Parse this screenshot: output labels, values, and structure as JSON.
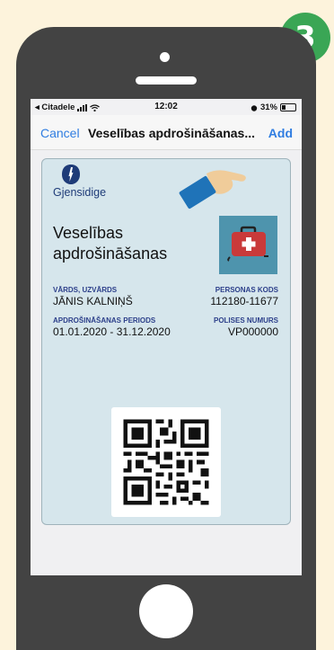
{
  "step": {
    "number": "3",
    "color": "#3aa655"
  },
  "status_bar": {
    "carrier": "◂ Citadele",
    "time": "12:02",
    "battery": "31%"
  },
  "nav": {
    "cancel": "Cancel",
    "title": "Veselības apdrošināšanas...",
    "add": "Add",
    "accent": "#2f7de1"
  },
  "pass": {
    "brand": "Gjensidige",
    "title": "Veselības apdrošināšanas",
    "icon": "first-aid-kit-icon",
    "name": {
      "label": "VĀRDS, UZVĀRDS",
      "value": "JĀNIS KALNIŅŠ"
    },
    "personal_code": {
      "label": "PERSONAS KODS",
      "value": "112180-11677"
    },
    "period": {
      "label": "APDROŠINĀŠANAS PERIODS",
      "value": "01.01.2020 - 31.12.2020"
    },
    "policy": {
      "label": "POLISES NUMURS",
      "value": "VP000000"
    },
    "barcode": "qr-code-icon"
  }
}
